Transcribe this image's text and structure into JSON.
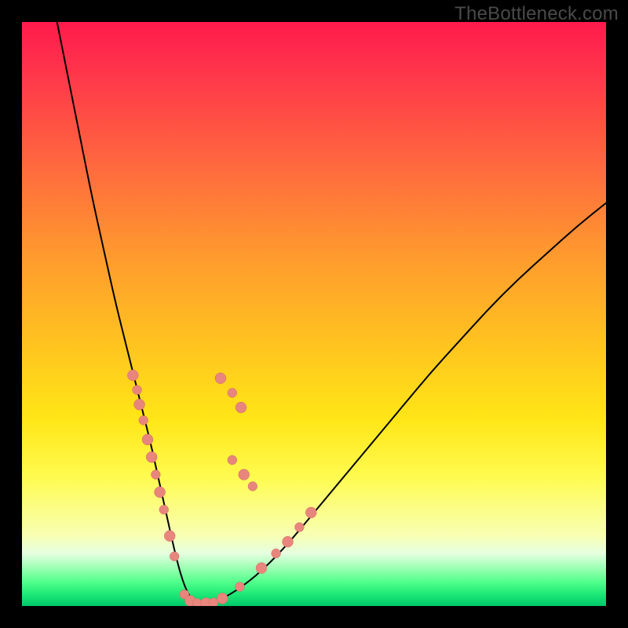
{
  "watermark": "TheBottleneck.com",
  "colors": {
    "curve_stroke": "#000000",
    "dot_fill": "#e8867d",
    "dot_stroke": "#d46a60"
  },
  "chart_data": {
    "type": "line",
    "title": "",
    "xlabel": "",
    "ylabel": "",
    "xlim": [
      0,
      100
    ],
    "ylim": [
      0,
      100
    ],
    "series": [
      {
        "name": "bottleneck-curve",
        "x": [
          6,
          8,
          10,
          12,
          14,
          16,
          18,
          20,
          22,
          23,
          24,
          25,
          26,
          27,
          28,
          29,
          30,
          32,
          35,
          40,
          45,
          50,
          55,
          60,
          65,
          70,
          75,
          80,
          85,
          90,
          95,
          100
        ],
        "y": [
          100,
          90,
          80,
          70,
          61,
          52,
          44,
          36,
          28,
          23.5,
          19,
          14.5,
          10,
          6,
          3,
          1.2,
          0.5,
          0.5,
          1.5,
          5,
          10,
          16,
          22,
          28,
          34,
          40,
          45.5,
          51,
          56,
          60.5,
          65,
          69
        ]
      }
    ],
    "dots": [
      {
        "x": 19.0,
        "y": 39.5,
        "r": 1.3
      },
      {
        "x": 19.7,
        "y": 37.0,
        "r": 1.1
      },
      {
        "x": 20.1,
        "y": 34.5,
        "r": 1.3
      },
      {
        "x": 20.8,
        "y": 31.8,
        "r": 1.1
      },
      {
        "x": 21.5,
        "y": 28.5,
        "r": 1.3
      },
      {
        "x": 22.2,
        "y": 25.5,
        "r": 1.3
      },
      {
        "x": 22.9,
        "y": 22.5,
        "r": 1.1
      },
      {
        "x": 23.6,
        "y": 19.5,
        "r": 1.3
      },
      {
        "x": 24.3,
        "y": 16.5,
        "r": 1.1
      },
      {
        "x": 25.3,
        "y": 12.0,
        "r": 1.3
      },
      {
        "x": 26.1,
        "y": 8.5,
        "r": 1.1
      },
      {
        "x": 27.8,
        "y": 2.0,
        "r": 1.1
      },
      {
        "x": 28.8,
        "y": 0.9,
        "r": 1.3
      },
      {
        "x": 30.0,
        "y": 0.5,
        "r": 1.1
      },
      {
        "x": 31.5,
        "y": 0.5,
        "r": 1.3
      },
      {
        "x": 32.8,
        "y": 0.6,
        "r": 1.1
      },
      {
        "x": 34.3,
        "y": 1.3,
        "r": 1.3
      },
      {
        "x": 37.3,
        "y": 3.3,
        "r": 1.1
      },
      {
        "x": 41.0,
        "y": 6.5,
        "r": 1.3
      },
      {
        "x": 43.5,
        "y": 9.0,
        "r": 1.1
      },
      {
        "x": 45.5,
        "y": 11.0,
        "r": 1.3
      },
      {
        "x": 47.5,
        "y": 13.5,
        "r": 1.1
      },
      {
        "x": 49.5,
        "y": 16.0,
        "r": 1.3
      },
      {
        "x": 34.0,
        "y": 39.0,
        "r": 1.3
      },
      {
        "x": 36.0,
        "y": 36.5,
        "r": 1.1
      },
      {
        "x": 37.5,
        "y": 34.0,
        "r": 1.3
      },
      {
        "x": 36.0,
        "y": 25.0,
        "r": 1.1
      },
      {
        "x": 38.0,
        "y": 22.5,
        "r": 1.3
      },
      {
        "x": 39.5,
        "y": 20.5,
        "r": 1.1
      }
    ]
  }
}
